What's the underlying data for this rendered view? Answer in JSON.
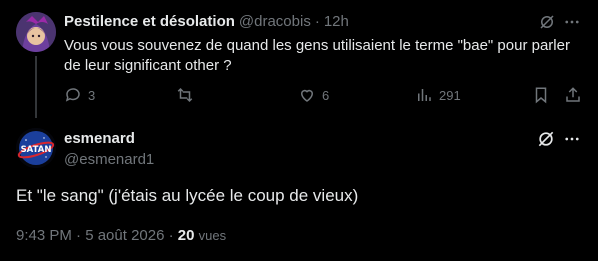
{
  "reply": {
    "author_name": "Pestilence et désolation",
    "handle": "@dracobis",
    "separator": "·",
    "time": "12h",
    "text": "Vous vous souvenez de quand les gens utilisaient le terme \"bae\" pour parler de leur significant other ?",
    "stats": {
      "replies": "3",
      "likes": "6",
      "views": "291"
    }
  },
  "main_post": {
    "author_name": "esmenard",
    "handle": "@esmenard1",
    "avatar_text": "SATAN",
    "text": "Et \"le sang\" (j'étais au lycée le coup de vieux)",
    "timestamp": "9:43 PM · 5 août 2026 · ",
    "views_count": "20",
    "views_label": "vues"
  },
  "icons": {
    "grok": "grok-icon",
    "more": "more-icon",
    "reply": "reply-icon",
    "retweet": "retweet-icon",
    "like": "heart-icon",
    "views": "views-icon",
    "bookmark": "bookmark-icon",
    "share": "share-icon"
  },
  "colors": {
    "background": "#000000",
    "text_primary": "#e7e9ea",
    "text_secondary": "#71767b",
    "thread_line": "#333639"
  }
}
